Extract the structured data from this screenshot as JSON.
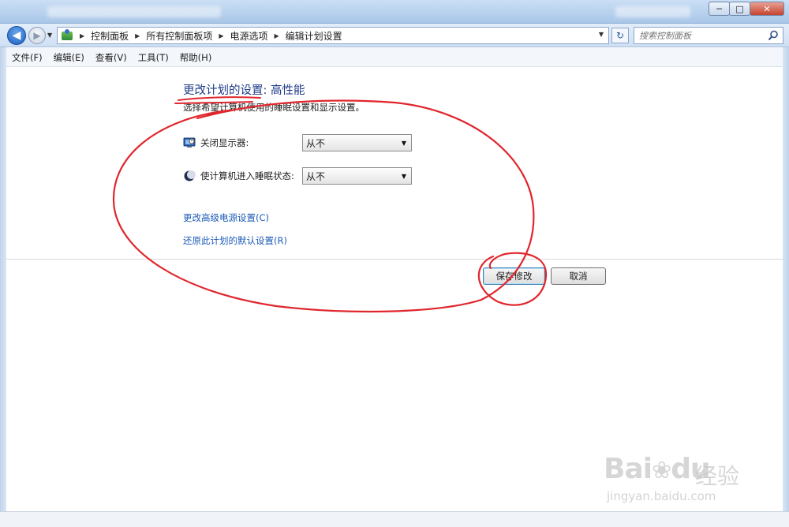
{
  "window": {
    "min_glyph": "─",
    "max_glyph": "□",
    "close_glyph": "✕"
  },
  "address": {
    "crumbs": [
      "控制面板",
      "所有控制面板项",
      "电源选项",
      "编辑计划设置"
    ],
    "search_placeholder": "搜索控制面板"
  },
  "menu": {
    "items": [
      "文件(F)",
      "编辑(E)",
      "查看(V)",
      "工具(T)",
      "帮助(H)"
    ]
  },
  "main": {
    "title": "更改计划的设置: 高性能",
    "subtitle": "选择希望计算机使用的睡眠设置和显示设置。",
    "settings": [
      {
        "label": "关闭显示器:",
        "value": "从不",
        "icon": "monitor-icon"
      },
      {
        "label": "使计算机进入睡眠状态:",
        "value": "从不",
        "icon": "moon-icon"
      }
    ],
    "links": [
      "更改高级电源设置(C)",
      "还原此计划的默认设置(R)"
    ],
    "buttons": {
      "save": "保存修改",
      "cancel": "取消"
    }
  },
  "annotation": {
    "color": "#e0262d"
  },
  "watermark": {
    "brand_latin": "Bai",
    "brand_latin_tail": "du",
    "brand_cn": "经验",
    "url": "jingyan.baidu.com"
  }
}
